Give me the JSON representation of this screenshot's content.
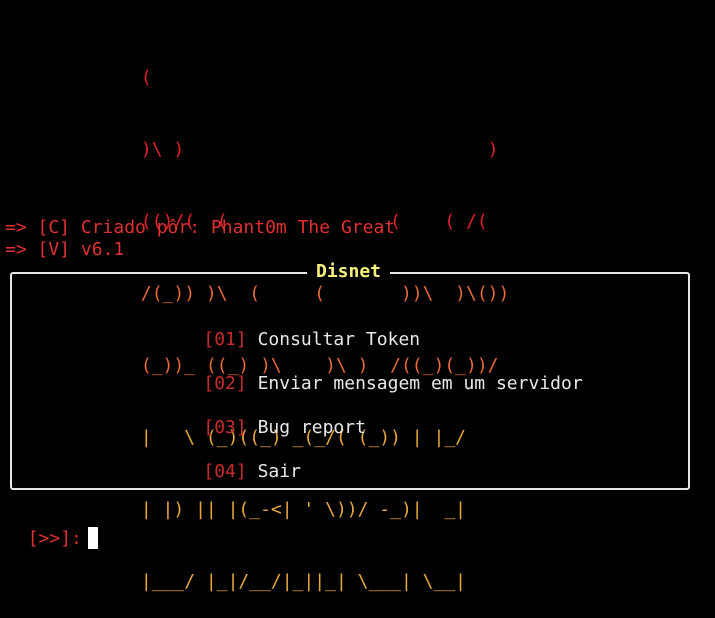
{
  "colors": {
    "background": "#000000",
    "ascii_top": "#e0202a",
    "ascii_bottom": "#e8a83c",
    "accent_red": "#e03030",
    "index_red": "#c92b2b",
    "title_yellow": "#f4f07c",
    "text": "#e8e8e8",
    "border": "#e6e6e6",
    "cursor": "#ffffff"
  },
  "banner": {
    "lines": [
      "             (",
      "             )\\ )                            )",
      "             (()/(  (               (    ( /(",
      "             /(_)) )\\  (     (       ))\\  )\\())",
      "             (_))_ ((_) )\\    )\\ )  /((_)(_))/",
      "             |   \\ (_)((_) _(_/( (_)) | |_/",
      "             | |) || |(_-<| ' \\))/ -_)|  _|",
      "             |___/ |_|/__/|_||_| \\___| \\__|"
    ]
  },
  "info": {
    "line1": "=> [C] Criado pôr: Phant0m The Great",
    "line2": "=> [V] v6.1"
  },
  "panel": {
    "title": "Disnet",
    "items": [
      {
        "index": "[01]",
        "label": "Consultar Token"
      },
      {
        "index": "[02]",
        "label": "Enviar mensagem em um servidor"
      },
      {
        "index": "[03]",
        "label": "Bug report"
      },
      {
        "index": "[04]",
        "label": "Sair"
      }
    ]
  },
  "prompt": {
    "text": "[>>]:",
    "cursor_icon": "block-cursor-icon"
  }
}
